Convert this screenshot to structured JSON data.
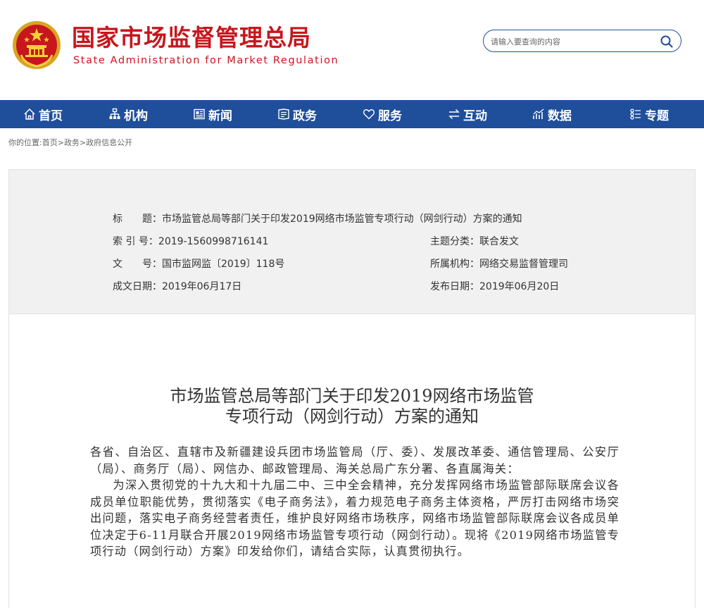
{
  "header": {
    "title": "国家市场监督管理总局",
    "subtitle": "State Administration for Market Regulation",
    "emblem_icon": "national-emblem-icon",
    "brand_color": "#c8161d"
  },
  "search": {
    "placeholder": "请输入要查询的内容",
    "icon": "search-icon"
  },
  "nav": {
    "color": "#1f4e9b",
    "items": [
      {
        "label": "首页",
        "icon": "home-icon"
      },
      {
        "label": "机构",
        "icon": "org-chart-icon"
      },
      {
        "label": "新闻",
        "icon": "newspaper-icon"
      },
      {
        "label": "政务",
        "icon": "government-icon"
      },
      {
        "label": "服务",
        "icon": "heart-icon"
      },
      {
        "label": "互动",
        "icon": "exchange-icon"
      },
      {
        "label": "数据",
        "icon": "chart-icon"
      },
      {
        "label": "专题",
        "icon": "topics-icon"
      }
    ]
  },
  "breadcrumb": {
    "prefix": "你的位置:",
    "items": [
      "首页",
      "政务",
      "政府信息公开"
    ],
    "separator": ">"
  },
  "info": {
    "title_label": "标　　题：",
    "title_value": "市场监管总局等部门关于印发2019网络市场监管专项行动（网剑行动）方案的通知",
    "index_label": "索 引 号：",
    "index_value": "2019-1560998716141",
    "category_label": "主题分类：",
    "category_value": "联合发文",
    "docno_label": "文　　号：",
    "docno_value": "国市监网监〔2019〕118号",
    "org_label": "所属机构：",
    "org_value": "网络交易监督管理司",
    "created_label": "成文日期：",
    "created_value": "2019年06月17日",
    "published_label": "发布日期：",
    "published_value": "2019年06月20日"
  },
  "document": {
    "title_line1": "市场监管总局等部门关于印发2019网络市场监管",
    "title_line2": "专项行动（网剑行动）方案的通知",
    "recipients": "各省、自治区、直辖市及新疆建设兵团市场监管局（厅、委）、发展改革委、通信管理局、公安厅（局）、商务厅（局）、网信办、邮政管理局、海关总局广东分署、各直属海关：",
    "paragraph1": "为深入贯彻党的十九大和十九届二中、三中全会精神，充分发挥网络市场监管部际联席会议各成员单位职能优势，贯彻落实《电子商务法》，着力规范电子商务主体资格，严厉打击网络市场突出问题，落实电子商务经营者责任，维护良好网络市场秩序，网络市场监管部际联席会议各成员单位决定于6-11月联合开展2019网络市场监管专项行动（网剑行动）。现将《2019网络市场监管专项行动（网剑行动）方案》印发给你们，请结合实际，认真贯彻执行。"
  }
}
